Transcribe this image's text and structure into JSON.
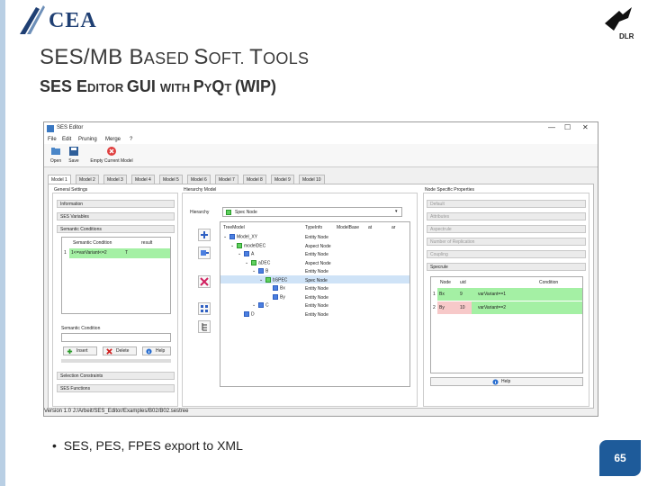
{
  "slide": {
    "title_main": [
      "SES/MB ",
      "B",
      "ASED ",
      "S",
      "OFT. ",
      "T",
      "OOLS"
    ],
    "title_sub": [
      "SES ",
      "E",
      "DITOR ",
      "GUI ",
      "WITH ",
      "P",
      "Y",
      "Q",
      "T ",
      "(WIP)"
    ],
    "bullet": "SES, PES, FPES export to XML",
    "page_number": "65",
    "logo_left": "CEA",
    "logo_right": "DLR"
  },
  "window": {
    "title": "SES Editor",
    "controls": [
      "—",
      "☐",
      "✕"
    ],
    "menu": [
      "File",
      "Edit",
      "Pruning",
      "Merge",
      "?"
    ],
    "toolbar": [
      "Open",
      "Save",
      "Empty Current Model"
    ],
    "tabs": [
      "Model 1",
      "Model 2",
      "Model 3",
      "Model 4",
      "Model 5",
      "Model 6",
      "Model 7",
      "Model 8",
      "Model 9",
      "Model 10"
    ],
    "status": "Version 1.0    J:/Arbeit/SES_Editor/Examples/B02/B02.sestree"
  },
  "general": {
    "title": "General Settings",
    "sections": [
      "Information",
      "SES Variables",
      "Semantic Conditions"
    ],
    "table_headers": [
      "Semantic Condition",
      "result"
    ],
    "rows": [
      {
        "n": "1",
        "cond": "1<=varVariant<=2",
        "result": "T"
      }
    ],
    "semantic_label": "Semantic Condition",
    "buttons": [
      "Insert",
      "Delete",
      "Help"
    ],
    "bottom_sections": [
      "Selection Constraints",
      "SES Functions"
    ]
  },
  "hierarchy": {
    "title": "Hierarchy Model",
    "label": "Hierarchy",
    "select_value": "Spec Node",
    "headers": [
      "TreeModel",
      "TypeInfo",
      "ModelBase",
      "at",
      "ar"
    ],
    "rows": [
      {
        "name": "Model_XY",
        "type": "Entity Node",
        "indent": 0,
        "color": "b"
      },
      {
        "name": "modelDEC",
        "type": "Aspect Node",
        "indent": 1,
        "color": "g"
      },
      {
        "name": "A",
        "type": "Entity Node",
        "indent": 2,
        "color": "b"
      },
      {
        "name": "aDEC",
        "type": "Aspect Node",
        "indent": 3,
        "color": "g"
      },
      {
        "name": "B",
        "type": "Entity Node",
        "indent": 4,
        "color": "b"
      },
      {
        "name": "bSPEC",
        "type": "Spec Node",
        "indent": 5,
        "color": "g"
      },
      {
        "name": "Bx",
        "type": "Entity Node",
        "indent": 6,
        "color": "b"
      },
      {
        "name": "By",
        "type": "Entity Node",
        "indent": 6,
        "color": "b"
      },
      {
        "name": "C",
        "type": "Entity Node",
        "indent": 4,
        "color": "b"
      },
      {
        "name": "D",
        "type": "Entity Node",
        "indent": 2,
        "color": "b"
      }
    ]
  },
  "node_props": {
    "title": "Node Specific Properties",
    "sections": [
      "Default",
      "Attributes",
      "Aspectrule",
      "Number of Replication",
      "Coupling",
      "Specrule"
    ],
    "headers": [
      "Node",
      "uid",
      "Condition"
    ],
    "rows": [
      {
        "n": "1",
        "node": "Bx",
        "uid": "9",
        "cond": "varVariant==1",
        "color": "green"
      },
      {
        "n": "2",
        "node": "By",
        "uid": "10",
        "cond": "varVariant==2",
        "color": "pink"
      }
    ],
    "help": "Help"
  }
}
